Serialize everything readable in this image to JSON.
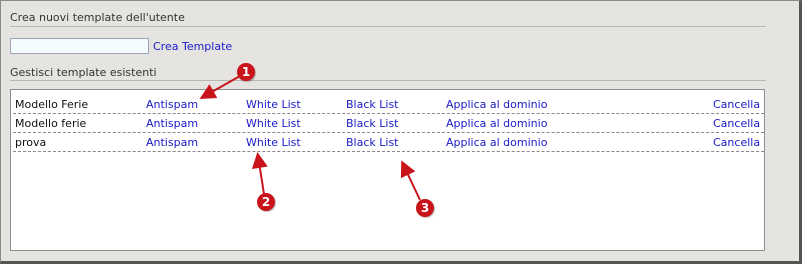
{
  "create_section": {
    "title": "Crea nuovi template dell'utente",
    "input_value": "",
    "button_label": "Crea Template"
  },
  "manage_section": {
    "title": "Gestisci template esistenti"
  },
  "templates": [
    {
      "name": "Modello Ferie",
      "antispam": "Antispam",
      "white_list": "White List",
      "black_list": "Black List",
      "apply_domain": "Applica al dominio",
      "delete": "Cancella"
    },
    {
      "name": "Modello ferie",
      "antispam": "Antispam",
      "white_list": "White List",
      "black_list": "Black List",
      "apply_domain": "Applica al dominio",
      "delete": "Cancella"
    },
    {
      "name": "prova",
      "antispam": "Antispam",
      "white_list": "White List",
      "black_list": "Black List",
      "apply_domain": "Applica al dominio",
      "delete": "Cancella"
    }
  ],
  "annotations": [
    {
      "label": "1"
    },
    {
      "label": "2"
    },
    {
      "label": "3"
    }
  ],
  "colors": {
    "link": "#1a1ac8",
    "annotation": "#c9141b",
    "background": "#e6e4e1"
  }
}
